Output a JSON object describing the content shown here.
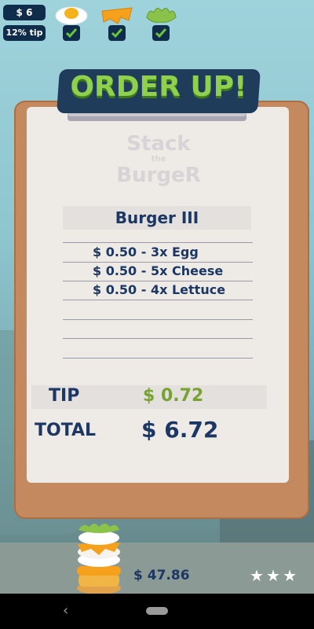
{
  "hud": {
    "money": "$ 6",
    "tip_percent": "12% tip",
    "ingredients": [
      {
        "name": "egg-icon",
        "checked": true
      },
      {
        "name": "cheese-icon",
        "checked": true
      },
      {
        "name": "lettuce-icon",
        "checked": true
      }
    ]
  },
  "title": "ORDER UP!",
  "logo": {
    "line1": "Stack",
    "line2": "the",
    "line3": "BurgeR"
  },
  "order": {
    "burger_name": "Burger III",
    "items": [
      "$ 0.50 - 3x Egg",
      "$ 0.50 - 5x Cheese",
      "$ 0.50 - 4x Lettuce"
    ],
    "tip_label": "TIP",
    "tip_value": "$ 0.72",
    "total_label": "TOTAL",
    "total_value": "$ 6.72"
  },
  "footer": {
    "earnings": "$ 47.86",
    "stars": 3,
    "star_glyph": "★"
  },
  "navbar": {
    "back_glyph": "‹"
  },
  "colors": {
    "text_dark": "#1c3763",
    "tip_green": "#78a331",
    "title_green": "#8fd14f",
    "hud_bg": "#0f2c4a",
    "board": "#c4895e",
    "paper": "#eeeae6"
  }
}
